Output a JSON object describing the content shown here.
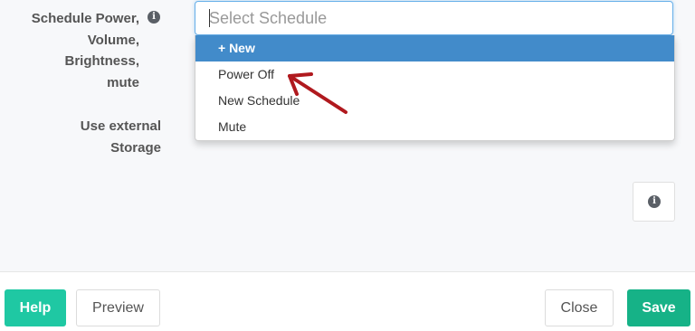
{
  "form": {
    "schedule_label_lines": [
      "Schedule Power,",
      "Volume,",
      "Brightness,",
      "mute"
    ],
    "storage_label_lines": [
      "Use external",
      "Storage"
    ],
    "info_icon_glyph": "i"
  },
  "schedule_select": {
    "placeholder": "Select Schedule",
    "value": "",
    "options": [
      {
        "label": "+ New",
        "highlighted": true
      },
      {
        "label": "Power Off",
        "highlighted": false
      },
      {
        "label": "New Schedule",
        "highlighted": false
      },
      {
        "label": "Mute",
        "highlighted": false
      }
    ]
  },
  "annotation": {
    "arrow_color": "#b0191e",
    "points_to": "Power Off"
  },
  "footer": {
    "help_label": "Help",
    "preview_label": "Preview",
    "close_label": "Close",
    "save_label": "Save"
  },
  "colors": {
    "primary_green": "#1fc8a3",
    "save_green": "#16b287",
    "highlight_blue": "#428bca"
  },
  "icons": {
    "info": "info-icon"
  }
}
